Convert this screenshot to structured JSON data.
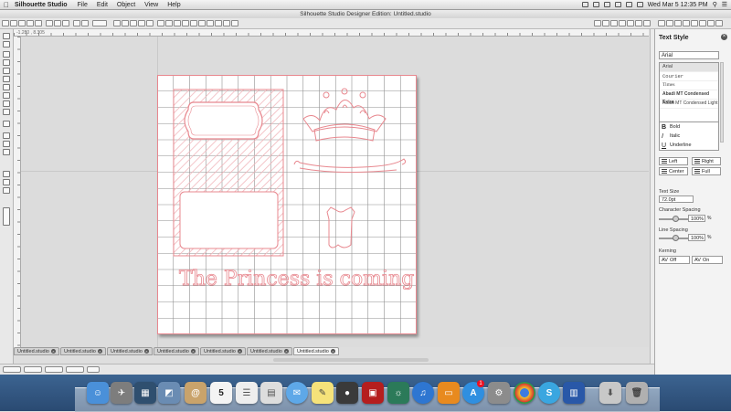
{
  "menubar": {
    "apple": "",
    "app_name": "Silhouette Studio",
    "items": [
      "File",
      "Edit",
      "Object",
      "View",
      "Help"
    ],
    "clock": "Wed Mar 5  12:35 PM"
  },
  "window": {
    "title": "Silhouette Studio Designer Edition: Untitled.studio"
  },
  "canvas": {
    "coords": "-1.280 , 8.305",
    "text_on_mat": "The Princess is coming"
  },
  "tabs": [
    {
      "label": "Untitled.studio",
      "active": false
    },
    {
      "label": "Untitled.studio",
      "active": false
    },
    {
      "label": "Untitled.studio",
      "active": false
    },
    {
      "label": "Untitled.studio",
      "active": false
    },
    {
      "label": "Untitled.studio",
      "active": false
    },
    {
      "label": "Untitled.studio",
      "active": false
    },
    {
      "label": "Untitled.studio",
      "active": true
    }
  ],
  "panel": {
    "title": "Text Style",
    "font_value": "Arial",
    "fonts": [
      "Arial",
      "Courier",
      "Times",
      "Abadi MT Condensed Extra",
      "Abadi MT Condensed Light"
    ],
    "styles": [
      {
        "glyph": "B",
        "label": "Bold"
      },
      {
        "glyph": "I",
        "label": "Italic"
      },
      {
        "glyph": "U",
        "label": "Underline"
      }
    ],
    "align": {
      "left": "Left",
      "right": "Right",
      "center": "Center",
      "full": "Full"
    },
    "text_size_label": "Text Size",
    "text_size_value": "72.0pt",
    "char_spacing_label": "Character Spacing",
    "char_spacing_value": "100%",
    "line_spacing_label": "Line Spacing",
    "line_spacing_value": "100%",
    "percent": "%",
    "kerning_label": "Kerning",
    "kerning_off": "Off",
    "kerning_on": "On"
  },
  "colors": {
    "cut_line": "#e8888f",
    "grid": "#8f8f8f",
    "accent": "#3b7bd5"
  },
  "dock": {
    "icons": [
      "finder-icon",
      "launchpad-icon",
      "mission-control-icon",
      "preview-icon",
      "contacts-icon",
      "calendar-icon",
      "reminders-icon",
      "itunes-photos-icon",
      "messages-icon",
      "stickies-icon",
      "facetime-icon",
      "photo-booth-icon",
      "iphoto-icon",
      "itunes-icon",
      "ibooks-icon",
      "app-store-icon",
      "system-preferences-icon",
      "chrome-icon",
      "silhouette-icon",
      "preview-docs-icon",
      "downloads-icon",
      "trash-icon"
    ],
    "calendar_day": "5",
    "appstore_badge": "1"
  }
}
